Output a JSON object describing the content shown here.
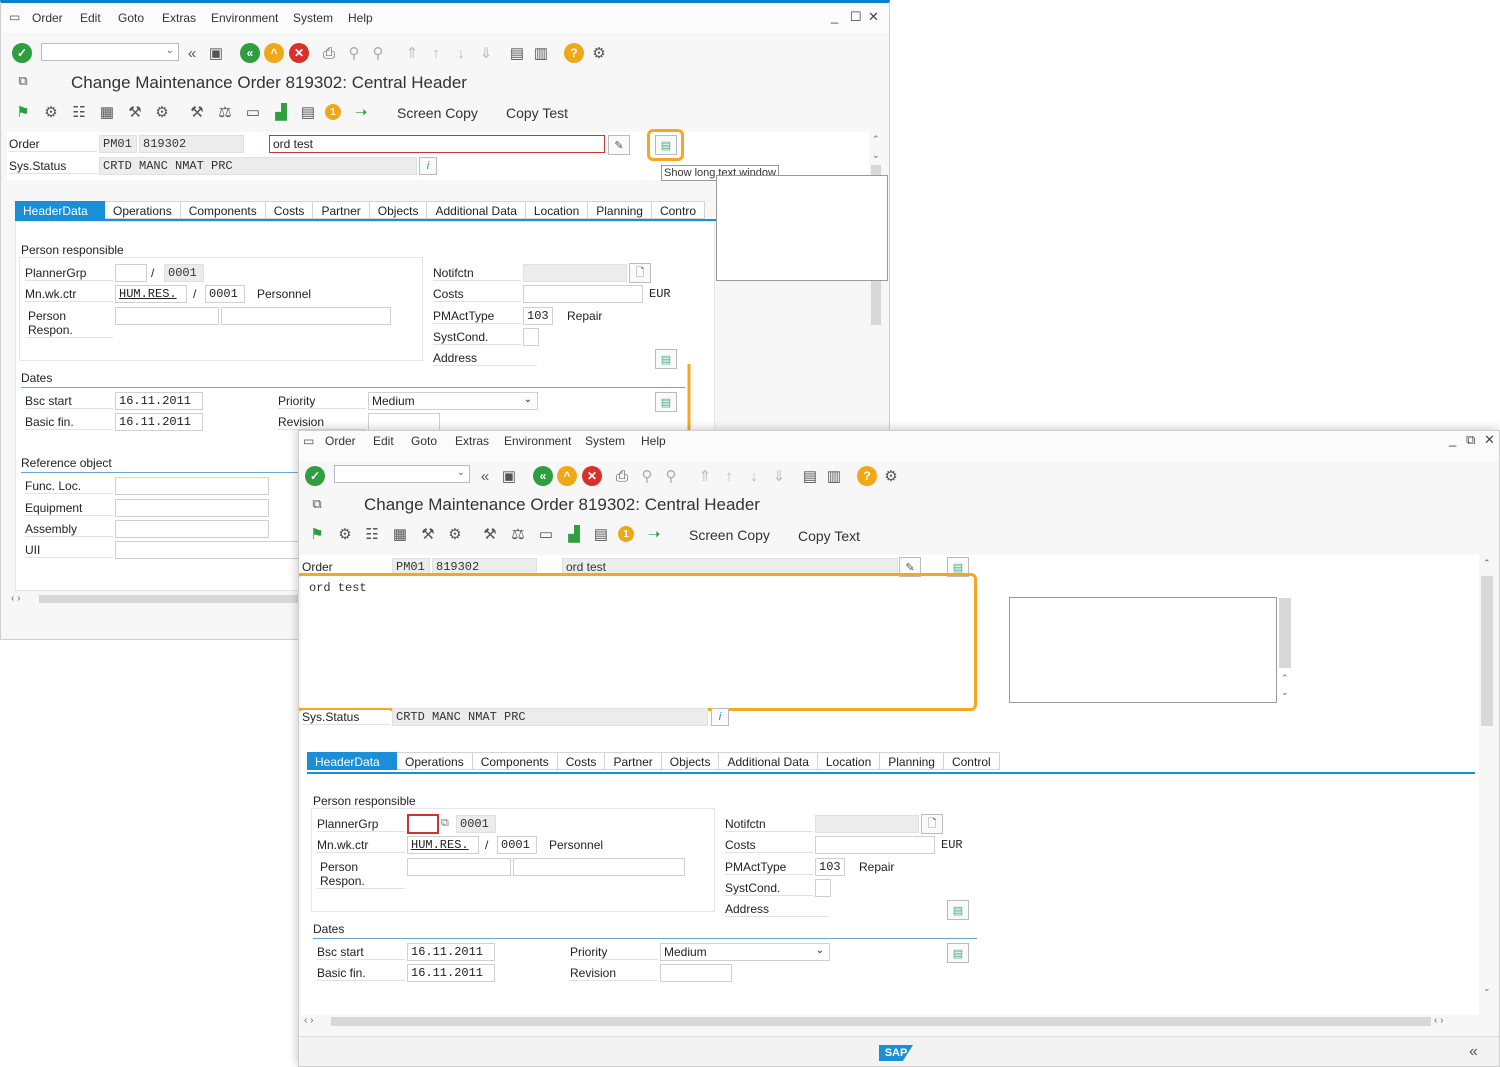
{
  "menu": [
    "Order",
    "Edit",
    "Goto",
    "Extras",
    "Environment",
    "System",
    "Help"
  ],
  "title": "Change Maintenance Order 819302: Central Header",
  "app_buttons": {
    "screen_copy": "Screen Copy",
    "copy_text_top": "Copy Test",
    "copy_text_bottom": "Copy Text"
  },
  "header": {
    "order_label": "Order",
    "order_type": "PM01",
    "order_number": "819302",
    "order_desc": "ord test",
    "status_label": "Sys.Status",
    "status_value": "CRTD  MANC  NMAT  PRC"
  },
  "tooltip": "Show long text window",
  "long_text": "ord test",
  "tabs_top": [
    "HeaderData",
    "Operations",
    "Components",
    "Costs",
    "Partner",
    "Objects",
    "Additional Data",
    "Location",
    "Planning",
    "Contro"
  ],
  "tabs_bottom": [
    "HeaderData",
    "Operations",
    "Components",
    "Costs",
    "Partner",
    "Objects",
    "Additional Data",
    "Location",
    "Planning",
    "Control"
  ],
  "person": {
    "group": "Person responsible",
    "planner_label": "PlannerGrp",
    "planner_sep": "/",
    "planner_val": "0001",
    "wkctr_label": "Mn.wk.ctr",
    "wkctr_val": "HUM.RES.",
    "wkctr_sep": "/",
    "wkctr_plant": "0001",
    "wkctr_text": "Personnel",
    "respon_label": "Person Respon."
  },
  "notif": {
    "notif_label": "Notifctn",
    "costs_label": "Costs",
    "currency": "EUR",
    "acttype_label": "PMActType",
    "acttype_val": "103",
    "acttype_text": "Repair",
    "systcond_label": "SystCond.",
    "address_label": "Address"
  },
  "dates": {
    "group": "Dates",
    "start_label": "Bsc start",
    "start_val": "16.11.2011",
    "fin_label": "Basic fin.",
    "fin_val": "16.11.2011",
    "priority_label": "Priority",
    "priority_val": "Medium",
    "revision_label": "Revision"
  },
  "refobj": {
    "group": "Reference object",
    "func_loc": "Func. Loc.",
    "equipment": "Equipment",
    "assembly": "Assembly",
    "uii": "UII"
  },
  "colors": {
    "accent": "#1a8fd8",
    "highlight": "#f5a623",
    "green": "#2e9e3e",
    "red": "#d9302b",
    "yellow": "#f0a818"
  },
  "sap_logo": "SAP"
}
